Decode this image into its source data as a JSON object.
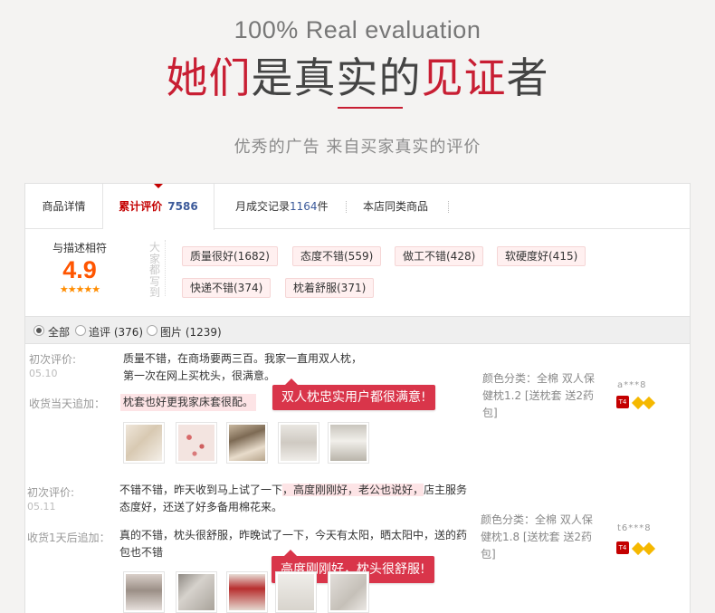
{
  "hero": {
    "en": "100% Real evaluation",
    "cn_black1": "她们是真实的",
    "cn_red1": "她们",
    "cn_black2": "是真实的",
    "cn_red2": "见证",
    "cn_black3": "者",
    "subtitle": "优秀的广告 来自买家真实的评价"
  },
  "tabs": {
    "detail": "商品详情",
    "reviews_label": "累计评价",
    "reviews_count": "7586",
    "sales_label": "月成交记录",
    "sales_count": "1164",
    "sales_unit": "件",
    "same_items": "本店同类商品"
  },
  "rating": {
    "label": "与描述相符",
    "score": "4.9",
    "stars": "★★★★★",
    "vertical_label": "大家都写到"
  },
  "tags": [
    "质量很好(1682)",
    "态度不错(559)",
    "做工不错(428)",
    "软硬度好(415)",
    "快递不错(374)",
    "枕着舒服(371)"
  ],
  "filters": {
    "all": "全部",
    "followup": "追评 (376)",
    "photos": "图片 (1239)"
  },
  "reviews": [
    {
      "first_label": "初次评价:",
      "date": "05.10",
      "text": "质量不错，在商场要两三百。我家一直用双人枕，第一次在网上买枕头，很满意。",
      "add_label": "收货当天追加：",
      "add_text": "枕套也好更我家床套很配。",
      "sku": "颜色分类：全棉 双人保健枕1.2 [送枕套 送2药包]",
      "user": "a***8",
      "callout": "双人枕忠实用户都很满意!"
    },
    {
      "first_label": "初次评价:",
      "date": "05.11",
      "text_a": "不错不错，昨天收到马上试了一下",
      "text_hl": "，高度刚刚好，老公也说好，",
      "text_b": "店主服务态度好，还送了好多备用棉花来。",
      "add_label": "收货1天后追加：",
      "add_text": "真的不错，枕头很舒服，昨晚试了一下，今天有太阳，晒太阳中，送的药包也不错",
      "sku": "颜色分类：全棉 双人保健枕1.8 [送枕套 送2药包]",
      "user": "t6***8",
      "callout": "高度刚刚好，枕头很舒服!"
    }
  ],
  "colors": {
    "accent_red": "#c81e33",
    "tag_bg": "#fff0f0",
    "score_orange": "#ff5500",
    "callout_bg": "#d9354a"
  }
}
